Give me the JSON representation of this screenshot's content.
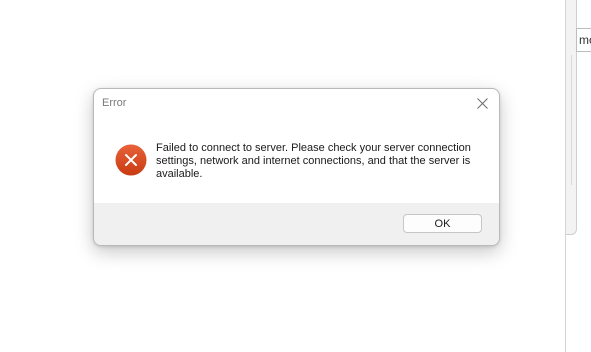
{
  "dialog": {
    "title": "Error",
    "message": "Failed to connect to server. Please check your server connection settings, network and internet connections, and that the server is available.",
    "ok_label": "OK",
    "icon": "error-icon",
    "close_icon": "close-icon"
  },
  "background_window": {
    "field_text": "mo"
  },
  "colors": {
    "error_icon": "#d9481c",
    "footer_bg": "#f0f0f0",
    "title_text": "#7a7a7a"
  }
}
